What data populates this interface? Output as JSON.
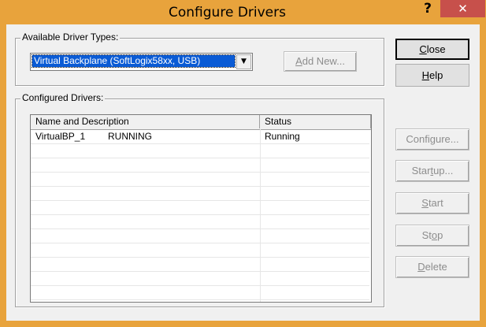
{
  "window": {
    "title": "Configure Drivers",
    "help_symbol": "?",
    "close_symbol": "✕"
  },
  "available_driver_types": {
    "label": "Available Driver Types:",
    "selected": "Virtual Backplane (SoftLogix58xx, USB)",
    "add_new": {
      "pre": "",
      "u": "A",
      "post": "dd New..."
    }
  },
  "configured_drivers": {
    "label": "Configured Drivers:",
    "columns": [
      "Name and Description",
      "Status"
    ],
    "rows": [
      {
        "name": "VirtualBP_1",
        "description": "RUNNING",
        "status": "Running"
      }
    ]
  },
  "buttons": {
    "close": {
      "pre": "",
      "u": "C",
      "post": "lose"
    },
    "help": {
      "pre": "",
      "u": "H",
      "post": "elp"
    },
    "configure": {
      "pre": "Confi",
      "u": "g",
      "post": "ure..."
    },
    "startup": {
      "pre": "Star",
      "u": "t",
      "post": "up..."
    },
    "start": {
      "pre": "",
      "u": "S",
      "post": "tart"
    },
    "stop": {
      "pre": "St",
      "u": "o",
      "post": "p"
    },
    "delete": {
      "pre": "",
      "u": "D",
      "post": "elete"
    }
  },
  "colors": {
    "title_bar": "#e8a33c",
    "close_button": "#c7504b",
    "selection": "#0a5bd5"
  }
}
